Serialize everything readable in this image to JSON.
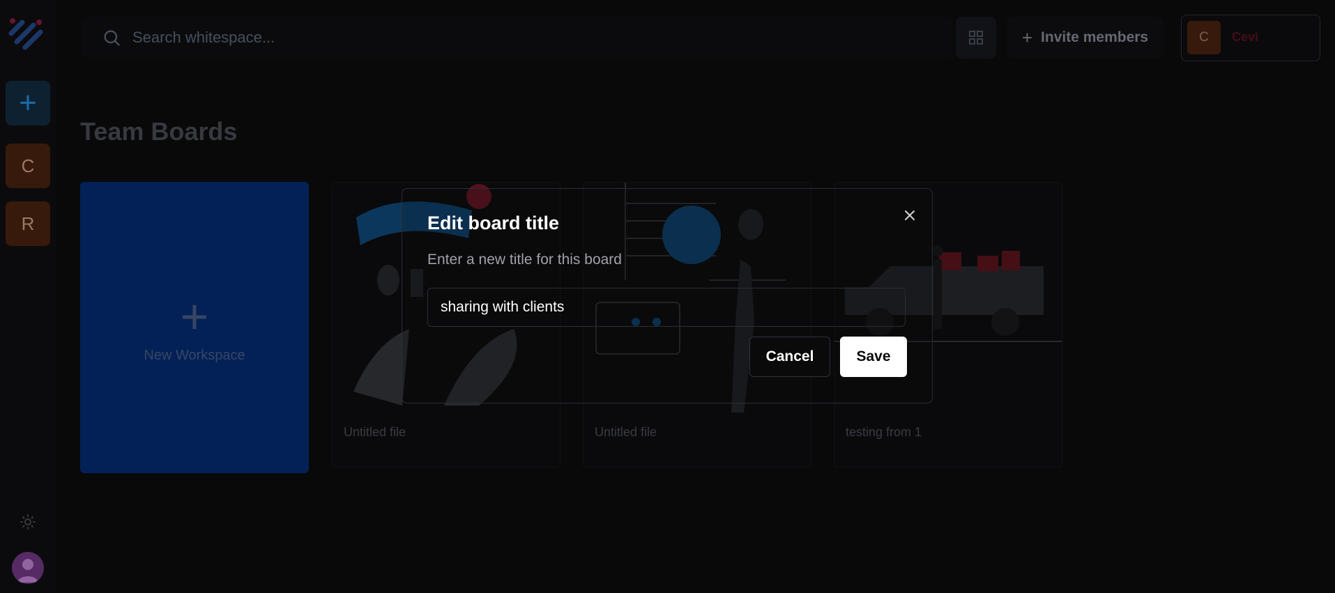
{
  "rail": {
    "add_label": "+",
    "workspaces": [
      "C",
      "R"
    ]
  },
  "search": {
    "placeholder": "Search whitespace..."
  },
  "header": {
    "invite_plus": "+",
    "invite_label": "Invite members",
    "account_initial": "C",
    "account_name": "Cevi"
  },
  "page": {
    "title": "Team Boards"
  },
  "new_workspace": {
    "plus": "+",
    "label": "New Workspace"
  },
  "boards": [
    {
      "caption": "Untitled file",
      "thumb": "parachute-illustration"
    },
    {
      "caption": "Untitled file",
      "thumb": "golf-illustration"
    },
    {
      "caption": "testing from 1",
      "thumb": "delivery-truck-illustration"
    }
  ],
  "modal": {
    "title": "Edit board title",
    "description": "Enter a new title for this board",
    "input_value": "sharing with clients",
    "cancel_label": "Cancel",
    "save_label": "Save"
  },
  "colors": {
    "background": "#0a0a0b",
    "accent_blue": "#04235b",
    "workspace_tile": "#3a1c0c",
    "save_button": "#ffffff"
  }
}
